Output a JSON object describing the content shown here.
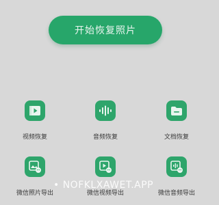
{
  "main": {
    "start_button_label": "开始恢复照片"
  },
  "features": [
    {
      "label": "视频恢复",
      "icon": "video-icon"
    },
    {
      "label": "音频恢复",
      "icon": "audio-waveform-icon"
    },
    {
      "label": "文档恢复",
      "icon": "folder-icon"
    },
    {
      "label": "微信照片导出",
      "icon": "wechat-photo-export-icon"
    },
    {
      "label": "微信视频导出",
      "icon": "wechat-video-export-icon"
    },
    {
      "label": "微信音频导出",
      "icon": "wechat-audio-export-icon"
    }
  ],
  "watermark": {
    "text": "• NOFKLXAWET.APP"
  },
  "colors": {
    "accent": "#27a66a",
    "background": "#d8d8d8"
  }
}
